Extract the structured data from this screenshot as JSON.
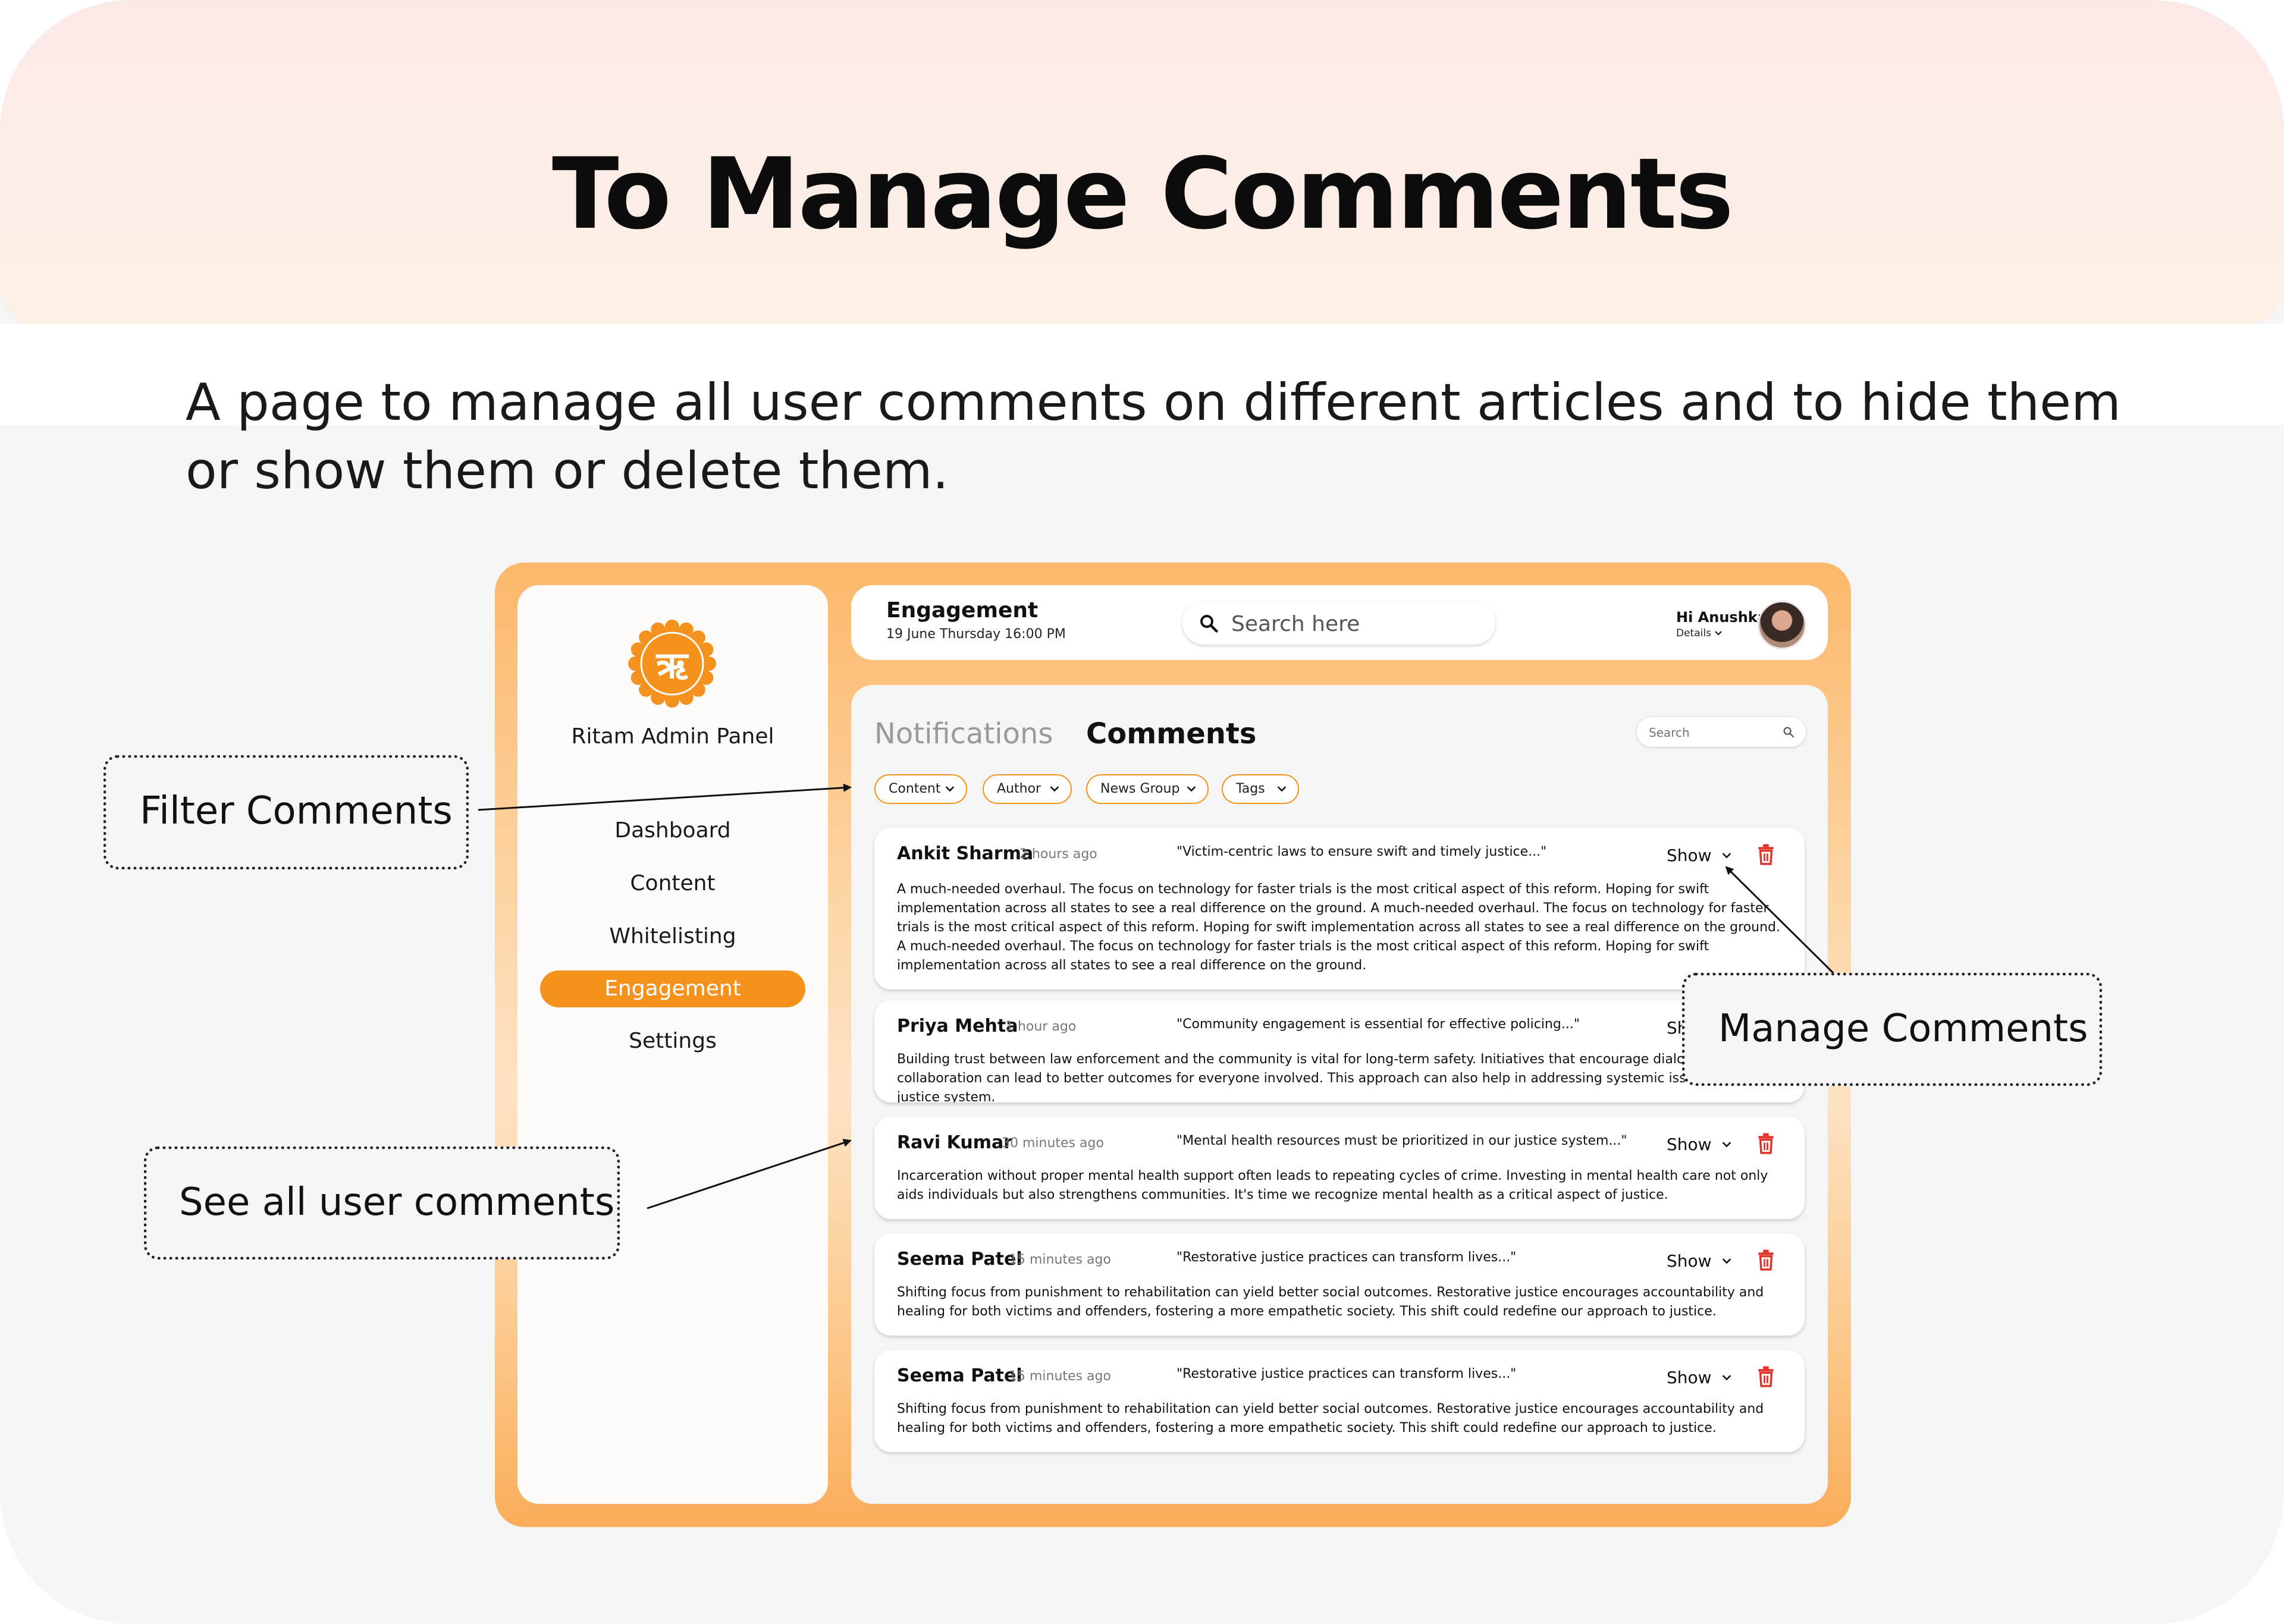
{
  "hero": {
    "title": "To Manage Comments"
  },
  "subtitle": "A page to manage all user comments on different articles and to hide them or show them or delete them.",
  "sidebar": {
    "brand": "Ritam Admin Panel",
    "logo_glyph": "ऋ",
    "items": [
      {
        "label": "Dashboard",
        "active": false
      },
      {
        "label": "Content",
        "active": false
      },
      {
        "label": "Whitelisting",
        "active": false
      },
      {
        "label": "Engagement",
        "active": true
      },
      {
        "label": "Settings",
        "active": false
      }
    ]
  },
  "topbar": {
    "title": "Engagement",
    "date": "19 June Thursday 16:00 PM",
    "search_placeholder": "Search here",
    "greeting": "Hi Anushka",
    "details_label": "Details"
  },
  "panel": {
    "tabs": [
      {
        "label": "Notifications",
        "active": false
      },
      {
        "label": "Comments",
        "active": true
      }
    ],
    "search_placeholder": "Search",
    "filters": [
      "Content",
      "Author",
      "News Group",
      "Tags"
    ]
  },
  "comments": [
    {
      "author": "Ankit Sharma",
      "time": "2 hours ago",
      "article": "\"Victim-centric laws to ensure swift and timely justice...\"",
      "visibility": "Show",
      "text": "A much-needed overhaul. The focus on technology for faster trials is the  most critical aspect of this reform. Hoping for swift implementation across all states to see a real difference on the ground. A much-needed overhaul. The focus on technology for faster trials is the  most critical aspect of this reform. Hoping for swift implementation  across all states to see a real difference on the ground. A much-needed overhaul. The focus on technology for faster trials is the  most critical aspect of this reform. Hoping for swift implementation  across all states to see a real difference on the ground."
    },
    {
      "author": "Priya Mehta",
      "time": "1 hour ago",
      "article": "\"Community engagement is essential for effective policing...\"",
      "visibility": "Show",
      "text": "Building trust between law enforcement and the community is vital for long-term safety. Initiatives that encourage dialogue and collaboration can lead to better outcomes for everyone involved. This approach can also help in addressing systemic issues within the justice system."
    },
    {
      "author": "Ravi Kumar",
      "time": "30 minutes ago",
      "article": "\"Mental health resources must be prioritized in our justice system...\"",
      "visibility": "Show",
      "text": "Incarceration without proper mental health support often leads to repeating cycles of crime. Investing in mental health care not only aids individuals but also strengthens communities. It's time we recognize mental health as a critical aspect of justice."
    },
    {
      "author": "Seema Patel",
      "time": "15 minutes ago",
      "article": "\"Restorative justice practices can transform lives...\"",
      "visibility": "Show",
      "text": "Shifting focus from punishment to rehabilitation can yield better social outcomes. Restorative justice encourages accountability and healing for both victims and offenders, fostering a more empathetic society. This shift could redefine our approach to justice."
    },
    {
      "author": "Seema Patel",
      "time": "15 minutes ago",
      "article": "\"Restorative justice practices can transform lives...\"",
      "visibility": "Show",
      "text": "Shifting focus from punishment to rehabilitation can yield better social outcomes. Restorative justice encourages accountability and healing for both victims and offenders, fostering a more empathetic society. This shift could redefine our approach to justice."
    }
  ],
  "callouts": {
    "filter": "Filter Comments",
    "manage": "Manage Comments",
    "see_all": "See all user comments"
  },
  "colors": {
    "accent": "#f5921e",
    "delete": "#e0342b"
  }
}
